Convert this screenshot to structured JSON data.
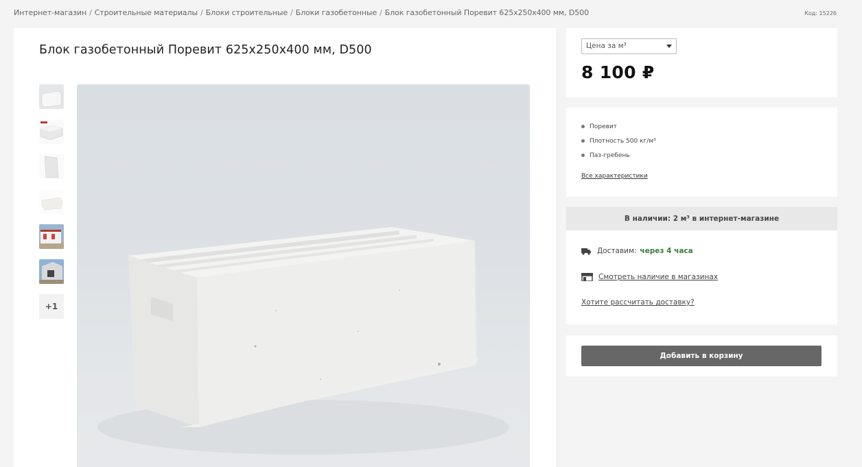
{
  "breadcrumb": {
    "items": [
      "Интернет-магазин",
      "Строительные материалы",
      "Блоки строительные",
      "Блоки газобетонные",
      "Блок газобетонный Поревит 625х250х400 мм, D500"
    ]
  },
  "product_code": "Код: 15226",
  "product": {
    "title": "Блок газобетонный Поревит 625х250х400 мм, D500",
    "more_thumbs": "+1"
  },
  "price": {
    "unit_select": "Цена за м³",
    "value": "8 100 ₽"
  },
  "characteristics": {
    "items": [
      "Поревит",
      "Плотность 500 кг/м³",
      "Паз-гребень"
    ],
    "all_link": "Все характеристики"
  },
  "stock": {
    "header": "В наличии: 2 м³ в интернет-магазине",
    "delivery_label": "Доставим:",
    "delivery_value": "через 4 часа",
    "shops_link": "Смотреть наличие в магазинах",
    "calc_link": "Хотите рассчитать доставку?"
  },
  "cart": {
    "button_label": "Добавить в корзину"
  },
  "icons": {
    "delivery": "truck-icon",
    "shops": "shop-icon",
    "select": "chevron-down-icon"
  }
}
